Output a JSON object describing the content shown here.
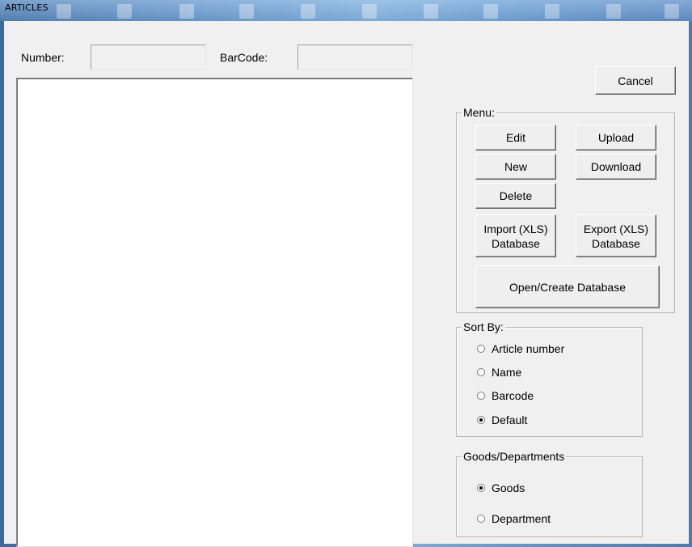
{
  "window": {
    "title": "ARTICLES"
  },
  "filter": {
    "number_label": "Number:",
    "number_value": "",
    "barcode_label": "BarCode:",
    "barcode_value": ""
  },
  "actions": {
    "cancel_label": "Cancel"
  },
  "menu": {
    "title": "Menu:",
    "edit_label": "Edit",
    "upload_label": "Upload",
    "new_label": "New",
    "download_label": "Download",
    "delete_label": "Delete",
    "import_label": "Import (XLS)\nDatabase",
    "export_label": "Export (XLS)\nDatabase",
    "open_create_label": "Open/Create Database"
  },
  "sort_by": {
    "title": "Sort By:",
    "options": [
      {
        "label": "Article number",
        "checked": false
      },
      {
        "label": "Name",
        "checked": false
      },
      {
        "label": "Barcode",
        "checked": false
      },
      {
        "label": "Default",
        "checked": true
      }
    ]
  },
  "goods_departments": {
    "title": "Goods/Departments",
    "options": [
      {
        "label": "Goods",
        "checked": true
      },
      {
        "label": "Department",
        "checked": false
      }
    ]
  }
}
